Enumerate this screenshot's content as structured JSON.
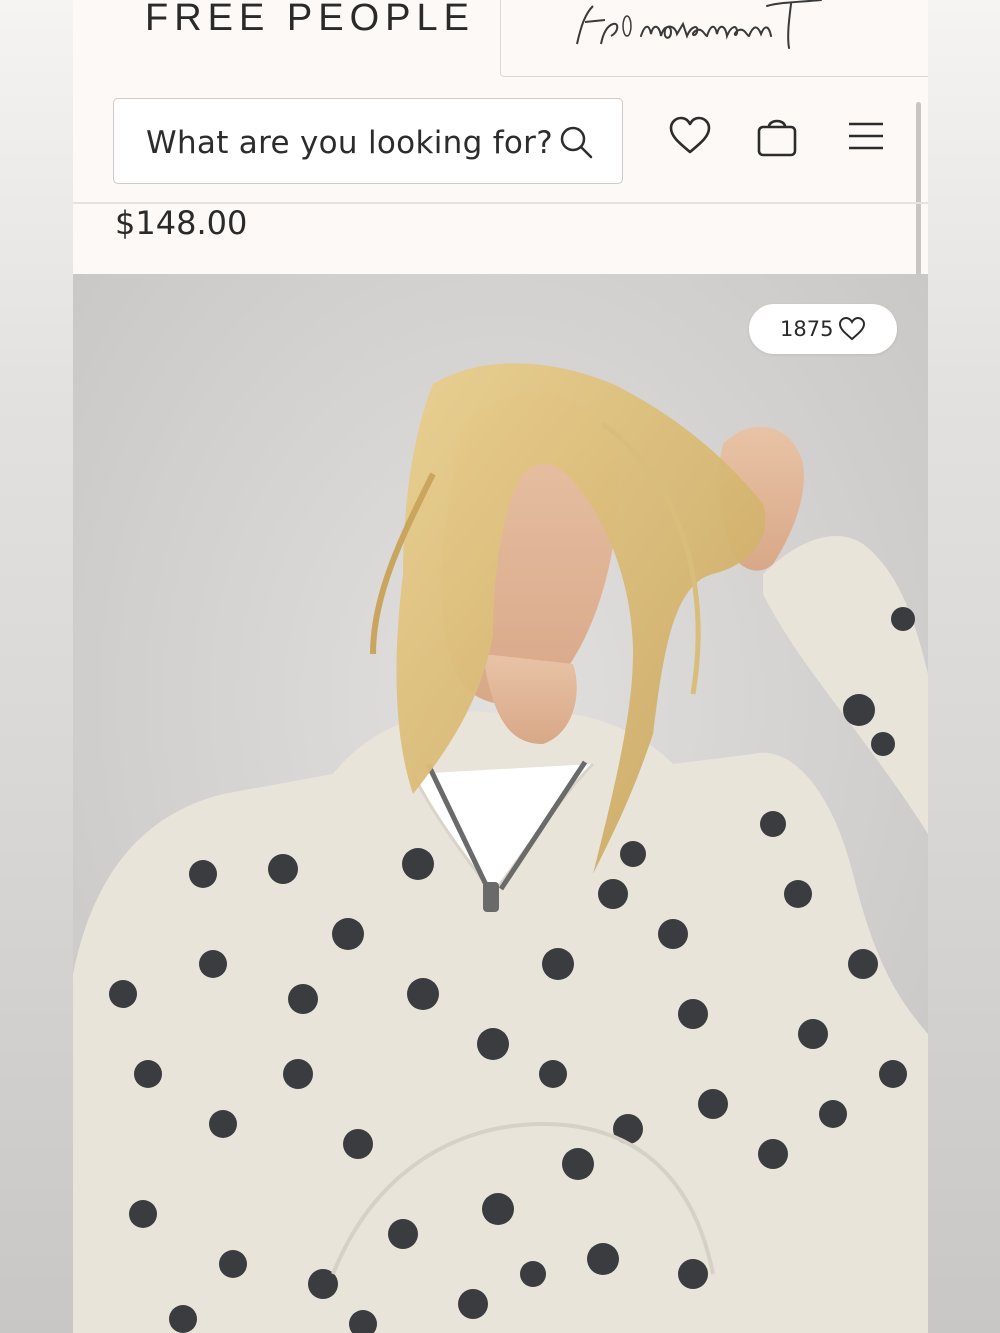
{
  "brand": {
    "logo_text": "FREE PEOPLE",
    "secondary_logo_text": "fp movement"
  },
  "header": {
    "search_placeholder": "What are you looking for?",
    "icons": [
      "search-icon",
      "heart-icon",
      "bag-icon",
      "menu-icon"
    ]
  },
  "product": {
    "price": "$148.00",
    "likes_count": "1875",
    "image_description": "Model wearing cream polka-dot half-zip sweatshirt"
  },
  "colors": {
    "page_bg": "#fcf9f7",
    "text": "#2a2a2a",
    "photo_bg": "#d6d4d2",
    "sweatshirt": "#e8e4da",
    "dots": "#3b3c40",
    "hair": "#d9b872"
  }
}
